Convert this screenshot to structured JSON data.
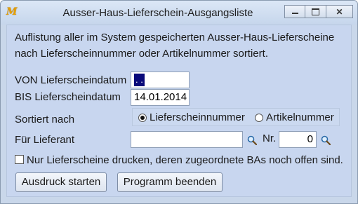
{
  "window": {
    "title": "Ausser-Haus-Lieferschein-Ausgangsliste",
    "app_icon_letter": "M",
    "controls": {
      "minimize_icon": "minimize-icon",
      "maximize_icon": "maximize-icon",
      "close": "✕"
    }
  },
  "description": "Auflistung aller im System gespeicherten Ausser-Haus-Lieferscheine nach Lieferscheinnummer oder Artikelnummer sortiert.",
  "form": {
    "von_label": "VON Lieferscheindatum",
    "von_value": " .  .",
    "bis_label": "BIS Lieferscheindatum",
    "bis_value": "14.01.2014",
    "sort_label": "Sortiert nach",
    "sort_options": [
      "Lieferscheinnummer",
      "Artikelnummer"
    ],
    "sort_selected": "Lieferscheinnummer",
    "lieferant_label": "Für Lieferant",
    "lieferant_value": "",
    "nr_label": "Nr.",
    "nr_value": "0",
    "checkbox_label": "Nur Lieferscheine drucken, deren zugeordnete BAs noch offen sind.",
    "checkbox_checked": false
  },
  "buttons": {
    "start": "Ausdruck starten",
    "end": "Programm beenden"
  },
  "colors": {
    "accent": "#0a0a7a",
    "panel": "#c8d6ef"
  }
}
